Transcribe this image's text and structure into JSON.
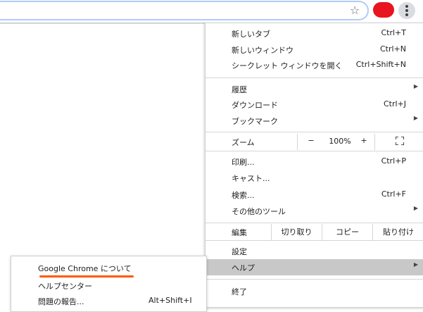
{
  "toolbar": {
    "star_icon": "star-icon",
    "profile_color": "#e8141e",
    "menu_icon": "three-dot-menu-icon"
  },
  "menu": {
    "new_tab": {
      "label": "新しいタブ",
      "accel": "Ctrl+T"
    },
    "new_window": {
      "label": "新しいウィンドウ",
      "accel": "Ctrl+N"
    },
    "new_incognito": {
      "label": "シークレット ウィンドウを開く",
      "accel": "Ctrl+Shift+N"
    },
    "history": {
      "label": "履歴"
    },
    "downloads": {
      "label": "ダウンロード",
      "accel": "Ctrl+J"
    },
    "bookmarks": {
      "label": "ブックマーク"
    },
    "zoom": {
      "label": "ズーム",
      "minus": "−",
      "value": "100%",
      "plus": "+"
    },
    "print": {
      "label": "印刷...",
      "accel": "Ctrl+P"
    },
    "cast": {
      "label": "キャスト..."
    },
    "find": {
      "label": "検索...",
      "accel": "Ctrl+F"
    },
    "more_tools": {
      "label": "その他のツール"
    },
    "edit": {
      "label": "編集",
      "cut": "切り取り",
      "copy": "コピー",
      "paste": "貼り付け"
    },
    "settings": {
      "label": "設定"
    },
    "help": {
      "label": "ヘルプ"
    },
    "exit": {
      "label": "終了"
    }
  },
  "help_submenu": {
    "about": {
      "label": "Google Chrome について"
    },
    "help_center": {
      "label": "ヘルプセンター"
    },
    "report_issue": {
      "label": "問題の報告...",
      "accel": "Alt+Shift+I"
    }
  },
  "colors": {
    "highlight": "#c8c8c8",
    "annotation_underline": "#ff5a00",
    "omnibox_focus": "#aecbfa"
  }
}
